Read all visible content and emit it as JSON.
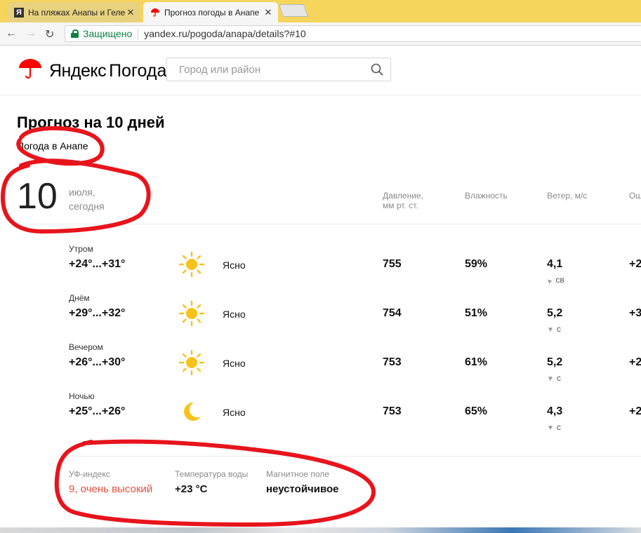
{
  "browser": {
    "tabs": [
      {
        "label": "На пляжах Анапы и Геле",
        "active": false
      },
      {
        "label": "Прогноз погоды в Анапе",
        "active": true
      }
    ],
    "secure_label": "Защищено",
    "url": "yandex.ru/pogoda/anapa/details?#10"
  },
  "header": {
    "logo_yandex": "Яндекс",
    "logo_pogoda": "Погода",
    "search_placeholder": "Город или район"
  },
  "page": {
    "title": "Прогноз на 10 дней",
    "subtitle": "Погода в Анапе"
  },
  "day": {
    "number": "10",
    "month": "июля,",
    "label": "сегодня"
  },
  "columns": {
    "pressure_l1": "Давление,",
    "pressure_l2": "мм рт. ст.",
    "humidity": "Влажность",
    "wind": "Ветер, м/с",
    "feels": "Ощ"
  },
  "rows": [
    {
      "part": "Утром",
      "temp": "+24°...+31°",
      "icon": "sun-icon",
      "condition": "Ясно",
      "pressure": "755",
      "humidity": "59%",
      "wind": "4,1",
      "wind_dir": "св",
      "wind_arrow": "➤",
      "feels": "+2"
    },
    {
      "part": "Днём",
      "temp": "+29°...+32°",
      "icon": "sun-icon",
      "condition": "Ясно",
      "pressure": "754",
      "humidity": "51%",
      "wind": "5,2",
      "wind_dir": "с",
      "wind_arrow": "▼",
      "feels": "+3"
    },
    {
      "part": "Вечером",
      "temp": "+26°...+30°",
      "icon": "sun-icon",
      "condition": "Ясно",
      "pressure": "753",
      "humidity": "61%",
      "wind": "5,2",
      "wind_dir": "с",
      "wind_arrow": "▼",
      "feels": "+2"
    },
    {
      "part": "Ночью",
      "temp": "+25°...+26°",
      "icon": "moon-icon",
      "condition": "Ясно",
      "pressure": "753",
      "humidity": "65%",
      "wind": "4,3",
      "wind_dir": "с",
      "wind_arrow": "▼",
      "feels": "+2"
    }
  ],
  "extras": {
    "uv_label": "УФ-индекс",
    "uv_value": "9, очень высокий",
    "water_label": "Температура воды",
    "water_value": "+23 °C",
    "magnetic_label": "Магнитное поле",
    "magnetic_value": "неустойчивое"
  },
  "colors": {
    "brand_red": "#f00",
    "uv_red": "#e4503e",
    "annotation": "#e8141c",
    "sun": "#f8c21a"
  }
}
